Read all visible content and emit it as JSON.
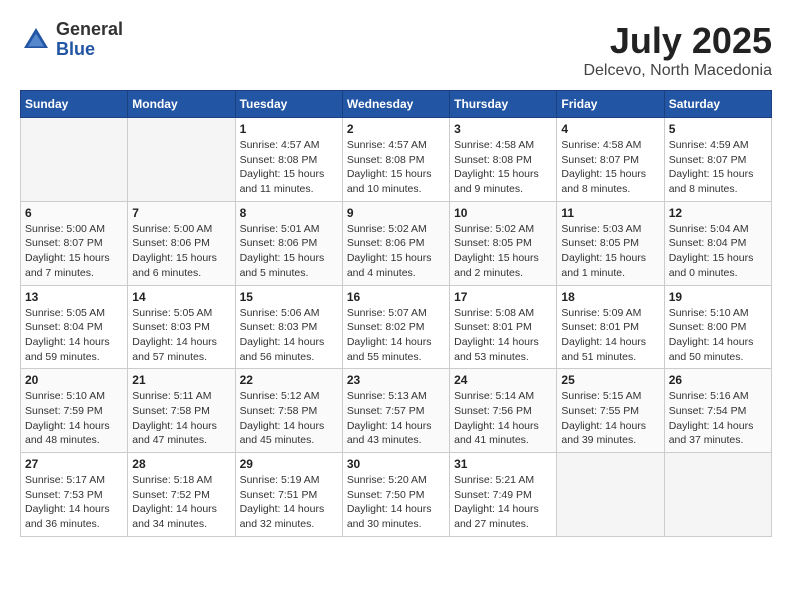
{
  "header": {
    "logo": {
      "general": "General",
      "blue": "Blue"
    },
    "title": "July 2025",
    "location": "Delcevo, North Macedonia"
  },
  "calendar": {
    "days_of_week": [
      "Sunday",
      "Monday",
      "Tuesday",
      "Wednesday",
      "Thursday",
      "Friday",
      "Saturday"
    ],
    "weeks": [
      [
        {
          "day": "",
          "empty": true
        },
        {
          "day": "",
          "empty": true
        },
        {
          "day": "1",
          "sunrise": "Sunrise: 4:57 AM",
          "sunset": "Sunset: 8:08 PM",
          "daylight": "Daylight: 15 hours and 11 minutes."
        },
        {
          "day": "2",
          "sunrise": "Sunrise: 4:57 AM",
          "sunset": "Sunset: 8:08 PM",
          "daylight": "Daylight: 15 hours and 10 minutes."
        },
        {
          "day": "3",
          "sunrise": "Sunrise: 4:58 AM",
          "sunset": "Sunset: 8:08 PM",
          "daylight": "Daylight: 15 hours and 9 minutes."
        },
        {
          "day": "4",
          "sunrise": "Sunrise: 4:58 AM",
          "sunset": "Sunset: 8:07 PM",
          "daylight": "Daylight: 15 hours and 8 minutes."
        },
        {
          "day": "5",
          "sunrise": "Sunrise: 4:59 AM",
          "sunset": "Sunset: 8:07 PM",
          "daylight": "Daylight: 15 hours and 8 minutes."
        }
      ],
      [
        {
          "day": "6",
          "sunrise": "Sunrise: 5:00 AM",
          "sunset": "Sunset: 8:07 PM",
          "daylight": "Daylight: 15 hours and 7 minutes."
        },
        {
          "day": "7",
          "sunrise": "Sunrise: 5:00 AM",
          "sunset": "Sunset: 8:06 PM",
          "daylight": "Daylight: 15 hours and 6 minutes."
        },
        {
          "day": "8",
          "sunrise": "Sunrise: 5:01 AM",
          "sunset": "Sunset: 8:06 PM",
          "daylight": "Daylight: 15 hours and 5 minutes."
        },
        {
          "day": "9",
          "sunrise": "Sunrise: 5:02 AM",
          "sunset": "Sunset: 8:06 PM",
          "daylight": "Daylight: 15 hours and 4 minutes."
        },
        {
          "day": "10",
          "sunrise": "Sunrise: 5:02 AM",
          "sunset": "Sunset: 8:05 PM",
          "daylight": "Daylight: 15 hours and 2 minutes."
        },
        {
          "day": "11",
          "sunrise": "Sunrise: 5:03 AM",
          "sunset": "Sunset: 8:05 PM",
          "daylight": "Daylight: 15 hours and 1 minute."
        },
        {
          "day": "12",
          "sunrise": "Sunrise: 5:04 AM",
          "sunset": "Sunset: 8:04 PM",
          "daylight": "Daylight: 15 hours and 0 minutes."
        }
      ],
      [
        {
          "day": "13",
          "sunrise": "Sunrise: 5:05 AM",
          "sunset": "Sunset: 8:04 PM",
          "daylight": "Daylight: 14 hours and 59 minutes."
        },
        {
          "day": "14",
          "sunrise": "Sunrise: 5:05 AM",
          "sunset": "Sunset: 8:03 PM",
          "daylight": "Daylight: 14 hours and 57 minutes."
        },
        {
          "day": "15",
          "sunrise": "Sunrise: 5:06 AM",
          "sunset": "Sunset: 8:03 PM",
          "daylight": "Daylight: 14 hours and 56 minutes."
        },
        {
          "day": "16",
          "sunrise": "Sunrise: 5:07 AM",
          "sunset": "Sunset: 8:02 PM",
          "daylight": "Daylight: 14 hours and 55 minutes."
        },
        {
          "day": "17",
          "sunrise": "Sunrise: 5:08 AM",
          "sunset": "Sunset: 8:01 PM",
          "daylight": "Daylight: 14 hours and 53 minutes."
        },
        {
          "day": "18",
          "sunrise": "Sunrise: 5:09 AM",
          "sunset": "Sunset: 8:01 PM",
          "daylight": "Daylight: 14 hours and 51 minutes."
        },
        {
          "day": "19",
          "sunrise": "Sunrise: 5:10 AM",
          "sunset": "Sunset: 8:00 PM",
          "daylight": "Daylight: 14 hours and 50 minutes."
        }
      ],
      [
        {
          "day": "20",
          "sunrise": "Sunrise: 5:10 AM",
          "sunset": "Sunset: 7:59 PM",
          "daylight": "Daylight: 14 hours and 48 minutes."
        },
        {
          "day": "21",
          "sunrise": "Sunrise: 5:11 AM",
          "sunset": "Sunset: 7:58 PM",
          "daylight": "Daylight: 14 hours and 47 minutes."
        },
        {
          "day": "22",
          "sunrise": "Sunrise: 5:12 AM",
          "sunset": "Sunset: 7:58 PM",
          "daylight": "Daylight: 14 hours and 45 minutes."
        },
        {
          "day": "23",
          "sunrise": "Sunrise: 5:13 AM",
          "sunset": "Sunset: 7:57 PM",
          "daylight": "Daylight: 14 hours and 43 minutes."
        },
        {
          "day": "24",
          "sunrise": "Sunrise: 5:14 AM",
          "sunset": "Sunset: 7:56 PM",
          "daylight": "Daylight: 14 hours and 41 minutes."
        },
        {
          "day": "25",
          "sunrise": "Sunrise: 5:15 AM",
          "sunset": "Sunset: 7:55 PM",
          "daylight": "Daylight: 14 hours and 39 minutes."
        },
        {
          "day": "26",
          "sunrise": "Sunrise: 5:16 AM",
          "sunset": "Sunset: 7:54 PM",
          "daylight": "Daylight: 14 hours and 37 minutes."
        }
      ],
      [
        {
          "day": "27",
          "sunrise": "Sunrise: 5:17 AM",
          "sunset": "Sunset: 7:53 PM",
          "daylight": "Daylight: 14 hours and 36 minutes."
        },
        {
          "day": "28",
          "sunrise": "Sunrise: 5:18 AM",
          "sunset": "Sunset: 7:52 PM",
          "daylight": "Daylight: 14 hours and 34 minutes."
        },
        {
          "day": "29",
          "sunrise": "Sunrise: 5:19 AM",
          "sunset": "Sunset: 7:51 PM",
          "daylight": "Daylight: 14 hours and 32 minutes."
        },
        {
          "day": "30",
          "sunrise": "Sunrise: 5:20 AM",
          "sunset": "Sunset: 7:50 PM",
          "daylight": "Daylight: 14 hours and 30 minutes."
        },
        {
          "day": "31",
          "sunrise": "Sunrise: 5:21 AM",
          "sunset": "Sunset: 7:49 PM",
          "daylight": "Daylight: 14 hours and 27 minutes."
        },
        {
          "day": "",
          "empty": true
        },
        {
          "day": "",
          "empty": true
        }
      ]
    ]
  }
}
